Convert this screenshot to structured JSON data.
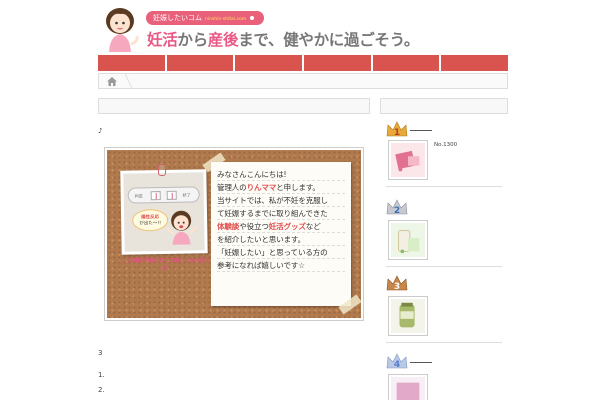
{
  "header": {
    "badge_text": "妊娠したいコム",
    "badge_url": "ninshin-shitai.com",
    "tagline": {
      "part1": "妊活",
      "part2": "から",
      "part3": "産後",
      "part4": "まで、健やかに過ごそう。"
    }
  },
  "nav": {
    "tab_count": 6
  },
  "content": {
    "note_mark": "♪",
    "greeting_lines": [
      {
        "a": "みなさんこんにちは!",
        "b": "",
        "c": ""
      },
      {
        "a": "管理人の",
        "b": "りんママ",
        "c": "と申します。"
      },
      {
        "a": "当サイトでは、私が不妊を克服し",
        "b": "",
        "c": ""
      },
      {
        "a": "て妊娠するまでに取り組んできた",
        "b": "",
        "c": ""
      },
      {
        "a": "",
        "b": "体験談",
        "c": "や役立つ"
      },
      {
        "a": "",
        "b": "妊活グッズ",
        "c": "など"
      },
      {
        "a": "を紹介したいと思います。",
        "b": "",
        "c": ""
      },
      {
        "a": "「妊娠したい」と思っている方の",
        "b": "",
        "c": ""
      },
      {
        "a": "参考になれば嬉しいです☆",
        "b": "",
        "c": ""
      }
    ],
    "bubble_line1": "陽性反応",
    "bubble_line2": "が出た〜!!",
    "stick_label_left": "判定",
    "stick_label_right": "終了",
    "photo_caption": "この結果が出るまでの道のりが大変でした…",
    "section_number": "3",
    "list_items": [
      "1.",
      "2."
    ]
  },
  "sidebar": {
    "ranks": [
      {
        "rank": "1",
        "product_code": "No.1300",
        "crown_color": "#e6a93a",
        "rank_color": "#c0392b"
      },
      {
        "rank": "2",
        "product_code": "",
        "crown_color": "#c6c9d0",
        "rank_color": "#3b6fb5"
      },
      {
        "rank": "3",
        "product_code": "",
        "crown_color": "#c8864a",
        "rank_color": "#b0562a"
      },
      {
        "rank": "4",
        "product_code": "",
        "crown_color": "#b8c9e8",
        "rank_color": "#5a7bd0"
      }
    ]
  },
  "colors": {
    "nav": "#d9534f",
    "accent_pink": "#e85a85",
    "badge": "#e8607a"
  }
}
